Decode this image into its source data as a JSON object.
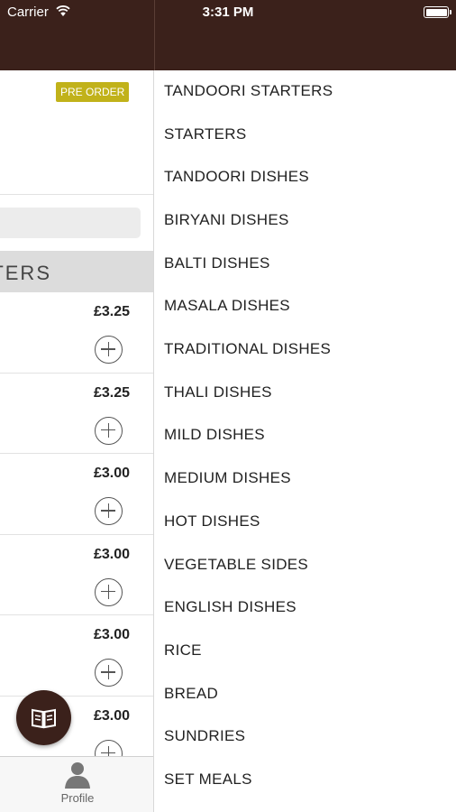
{
  "status_bar": {
    "carrier": "Carrier",
    "time": "3:31 PM"
  },
  "main": {
    "preorder_label": "PRE ORDER",
    "category_title": "TERS",
    "items": [
      {
        "price": "£3.25"
      },
      {
        "price": "£3.25"
      },
      {
        "price": "£3.00"
      },
      {
        "price": "£3.00"
      },
      {
        "price": "£3.00"
      },
      {
        "price": "£3.00"
      }
    ]
  },
  "tabbar": {
    "profile_label": "Profile"
  },
  "menu": {
    "items": [
      "TANDOORI STARTERS",
      "STARTERS",
      "TANDOORI DISHES",
      "BIRYANI DISHES",
      "BALTI DISHES",
      "MASALA DISHES",
      "TRADITIONAL DISHES",
      "THALI DISHES",
      "MILD DISHES",
      "MEDIUM DISHES",
      "HOT DISHES",
      "VEGETABLE SIDES",
      "ENGLISH DISHES",
      "RICE",
      "BREAD",
      "SUNDRIES",
      "SET MEALS"
    ]
  },
  "colors": {
    "nav_brown": "#3b211b",
    "preorder_badge": "#c1b21a",
    "category_header": "#dcdcdc"
  },
  "icons": [
    "wifi-icon",
    "battery-icon",
    "add-icon",
    "menu-book-icon",
    "profile-icon"
  ]
}
